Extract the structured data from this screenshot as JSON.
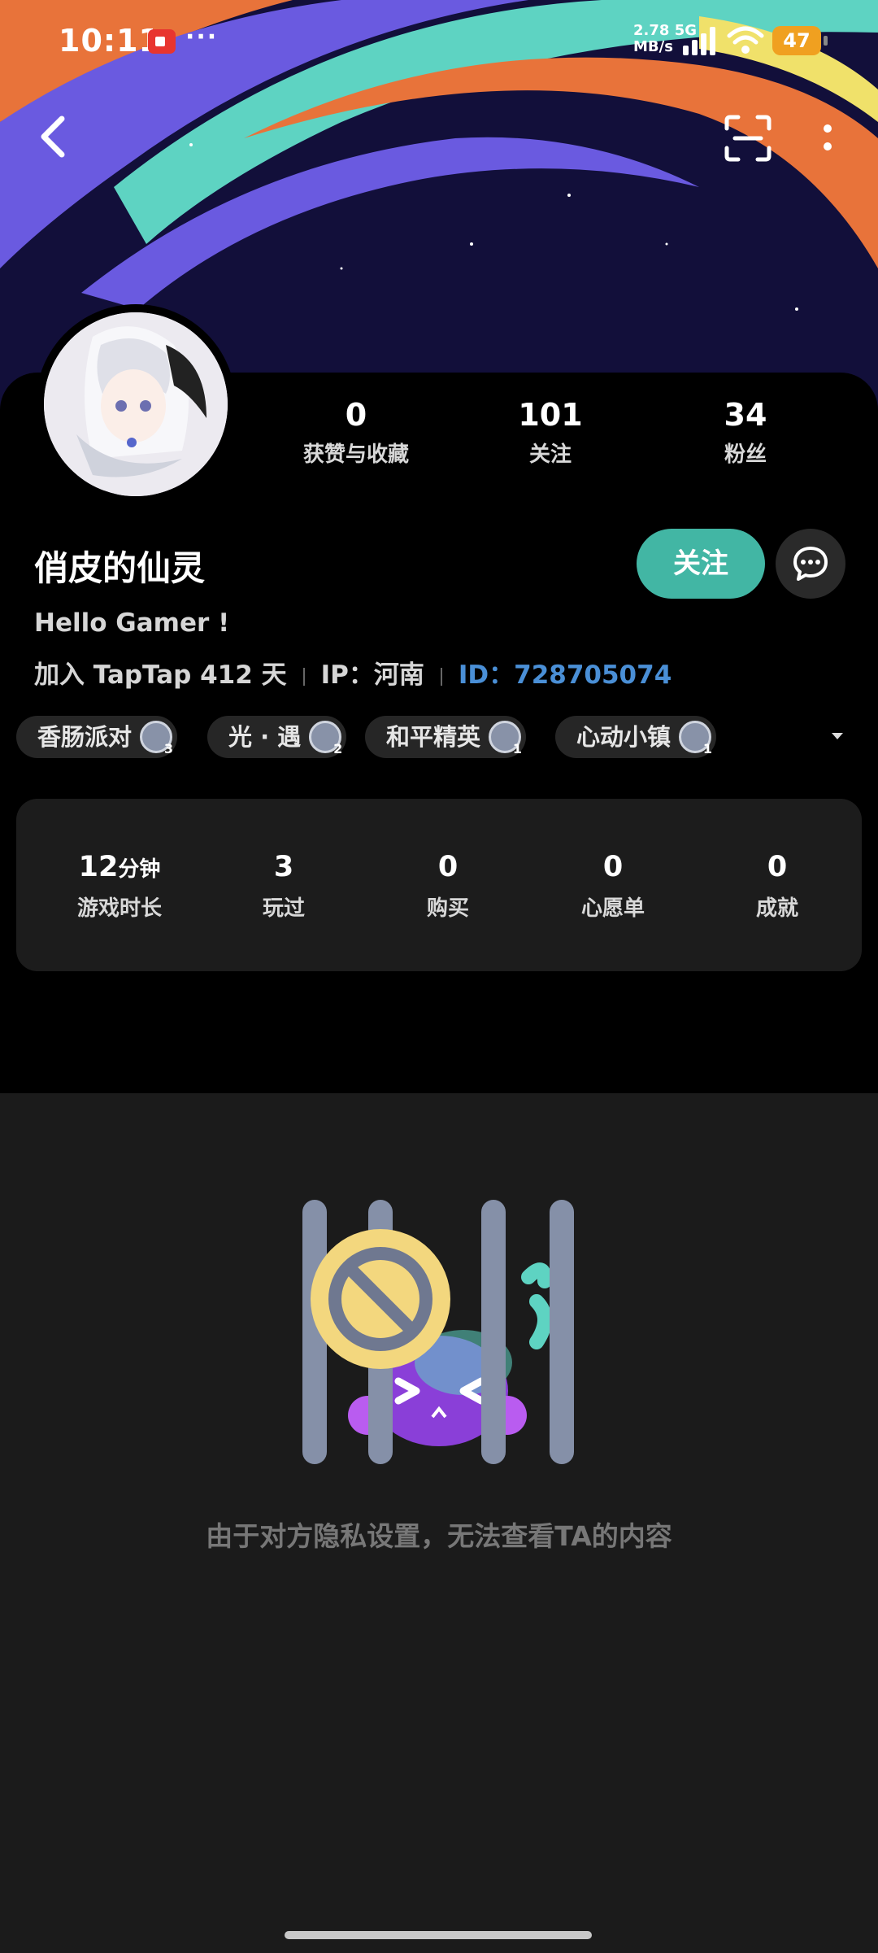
{
  "status_bar": {
    "time": "10:11",
    "net_speed_value": "2.78",
    "net_speed_unit": "MB/s",
    "network": "5G",
    "battery": "47"
  },
  "profile": {
    "username": "俏皮的仙灵",
    "bio": "Hello Gamer !",
    "join_text": "加入 TapTap 412 天",
    "ip_text": "IP：河南",
    "id_text": "ID：728705074",
    "follow_label": "关注",
    "stats": [
      {
        "num": "0",
        "label": "获赞与收藏"
      },
      {
        "num": "101",
        "label": "关注"
      },
      {
        "num": "34",
        "label": "粉丝"
      }
    ]
  },
  "tags": [
    {
      "name": "香肠派对",
      "level": "3"
    },
    {
      "name": "光 · 遇",
      "level": "2"
    },
    {
      "name": "和平精英",
      "level": "1"
    },
    {
      "name": "心动小镇",
      "level": "1"
    }
  ],
  "game_stats": [
    {
      "num": "12",
      "unit": "分钟",
      "label": "游戏时长"
    },
    {
      "num": "3",
      "unit": "",
      "label": "玩过"
    },
    {
      "num": "0",
      "unit": "",
      "label": "购买"
    },
    {
      "num": "0",
      "unit": "",
      "label": "心愿单"
    },
    {
      "num": "0",
      "unit": "",
      "label": "成就"
    }
  ],
  "empty_state": {
    "message": "由于对方隐私设置，无法查看TA的内容"
  },
  "colors": {
    "accent": "#42b6a4",
    "id_link": "#4a8fd6",
    "battery": "#f0a020"
  }
}
